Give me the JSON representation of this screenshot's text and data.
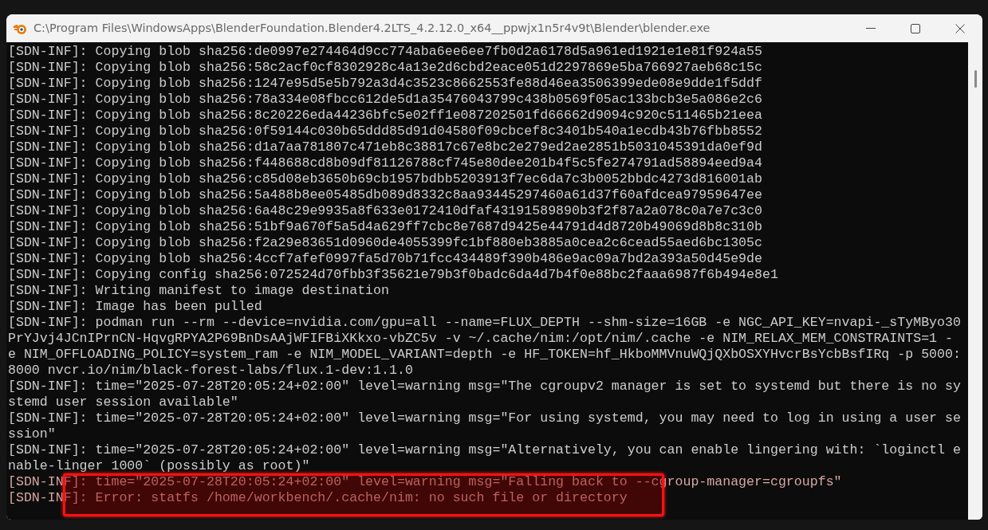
{
  "window": {
    "title": "C:\\Program Files\\WindowsApps\\BlenderFoundation.Blender4.2LTS_4.2.12.0_x64__ppwjx1n5r4v9t\\Blender\\blender.exe"
  },
  "console_lines": [
    {
      "text": "[SDN-INF]: Copying blob sha256:de0997e274464d9cc774aba6ee6ee7fb0d2a6178d5a961ed1921e1e81f924a55",
      "highlighted": false
    },
    {
      "text": "[SDN-INF]: Copying blob sha256:58c2acf0cf8302928c4a13e2d6cbd2eace051d2297869e5ba766927aeb68c15c",
      "highlighted": false
    },
    {
      "text": "[SDN-INF]: Copying blob sha256:1247e95d5e5b792a3d4c3523c8662553fe88d46ea3506399ede08e9dde1f5ddf",
      "highlighted": false
    },
    {
      "text": "[SDN-INF]: Copying blob sha256:78a334e08fbcc612de5d1a35476043799c438b0569f05ac133bcb3e5a086e2c6",
      "highlighted": false
    },
    {
      "text": "[SDN-INF]: Copying blob sha256:8c20226eda44236bfc5e02ff1e087202501fd66662d9094c920c511465b21eea",
      "highlighted": false
    },
    {
      "text": "[SDN-INF]: Copying blob sha256:0f59144c030b65ddd85d91d04580f09cbcef8c3401b540a1ecdb43b76fbb8552",
      "highlighted": false
    },
    {
      "text": "[SDN-INF]: Copying blob sha256:d1a7aa781807c471eb8c38817c67e8bc2e279ed2ae2851b5031045391da0ef9d",
      "highlighted": false
    },
    {
      "text": "[SDN-INF]: Copying blob sha256:f448688cd8b09df81126788cf745e80dee201b4f5c5fe274791ad58894eed9a4",
      "highlighted": false
    },
    {
      "text": "[SDN-INF]: Copying blob sha256:c85d08eb3650b69cb1957bdbb5203913f7ec6da7c3b0052bbdc4273d816001ab",
      "highlighted": false
    },
    {
      "text": "[SDN-INF]: Copying blob sha256:5a488b8ee05485db089d8332c8aa93445297460a61d37f60afdcea97959647ee",
      "highlighted": false
    },
    {
      "text": "[SDN-INF]: Copying blob sha256:6a48c29e9935a8f633e0172410dfaf43191589890b3f2f87a2a078c0a7e7c3c0",
      "highlighted": false
    },
    {
      "text": "[SDN-INF]: Copying blob sha256:51bf9a670f5a5d4a629ff7cbc8e7687d9425e44791d4d8720b49069d8b8c310b",
      "highlighted": false
    },
    {
      "text": "[SDN-INF]: Copying blob sha256:f2a29e83651d0960de4055399fc1bf880eb3885a0cea2c6cead55aed6bc1305c",
      "highlighted": false
    },
    {
      "text": "[SDN-INF]: Copying blob sha256:4ccf7afef0997fa5d70b71fcc434489f390b486e9ac09a7bd2a393a50d45e9de",
      "highlighted": false
    },
    {
      "text": "[SDN-INF]: Copying config sha256:072524d70fbb3f35621e79b3f0badc6da4d7b4f0e88bc2faaa6987f6b494e8e1",
      "highlighted": false
    },
    {
      "text": "[SDN-INF]: Writing manifest to image destination",
      "highlighted": false
    },
    {
      "text": "[SDN-INF]: Image has been pulled",
      "highlighted": false
    },
    {
      "text": "[SDN-INF]: podman run --rm --device=nvidia.com/gpu=all --name=FLUX_DEPTH --shm-size=16GB -e NGC_API_KEY=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 -v ~/.cache/nim:/opt/nim/.cache -e NIM_RELAX_MEM_CONSTRAINTS=1 -e NIM_OFFLOADING_POLICY=system_ram -e NIM_MODEL_VARIANT=depth -e HF_TOKEN=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 -p 5000:8000 nvcr.io/nim/black-forest-labs/flux.1-dev:1.1.0",
      "highlighted": false
    },
    {
      "text": "[SDN-INF]: time=\"2025-07-28T20:05:24+02:00\" level=warning msg=\"The cgroupv2 manager is set to systemd but there is no systemd user session available\"",
      "highlighted": false
    },
    {
      "text": "[SDN-INF]: time=\"2025-07-28T20:05:24+02:00\" level=warning msg=\"For using systemd, you may need to log in using a user session\"",
      "highlighted": false
    },
    {
      "text": "[SDN-INF]: time=\"2025-07-28T20:05:24+02:00\" level=warning msg=\"Alternatively, you can enable lingering with: `loginctl enable-linger 1000` (possibly as root)\"",
      "highlighted": false
    },
    {
      "text": "[SDN-INF]: time=\"2025-07-28T20:05:24+02:00\" level=warning msg=\"Falling back to --cgroup-manager=cgroupfs\"",
      "highlighted": true
    },
    {
      "text": "[SDN-INF]: Error: statfs /home/workbench/.cache/nim: no such file or directory",
      "highlighted": true
    }
  ]
}
